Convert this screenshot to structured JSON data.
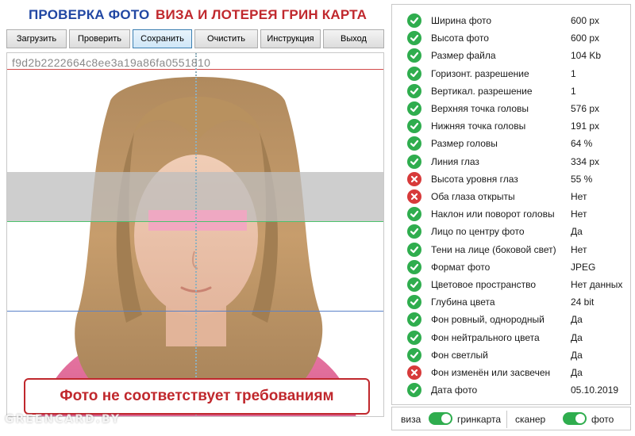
{
  "header": {
    "title_main": "ПРОВЕРКА ФОТО",
    "title_sub": "ВИЗА И ЛОТЕРЕЯ ГРИН КАРТА"
  },
  "toolbar": {
    "buttons": [
      {
        "label": "Загрузить",
        "active": false
      },
      {
        "label": "Проверить",
        "active": false
      },
      {
        "label": "Сохранить",
        "active": true
      },
      {
        "label": "Очистить",
        "active": false
      },
      {
        "label": "Инструкция",
        "active": false
      },
      {
        "label": "Выход",
        "active": false
      }
    ]
  },
  "photo": {
    "hash": "f9d2b2222664c8ee3a19a86fa0551810",
    "status_text": "Фото не соответствует требованиям",
    "watermark": "GREENCARD.BY"
  },
  "checks": [
    {
      "label": "Ширина фото",
      "value": "600 px",
      "status": "ok"
    },
    {
      "label": "Высота фото",
      "value": "600 px",
      "status": "ok"
    },
    {
      "label": "Размер файла",
      "value": "104 Kb",
      "status": "ok"
    },
    {
      "label": "Горизонт. разрешение",
      "value": "1",
      "status": "ok"
    },
    {
      "label": "Вертикал. разрешение",
      "value": "1",
      "status": "ok"
    },
    {
      "label": "Верхняя точка головы",
      "value": "576 px",
      "status": "ok"
    },
    {
      "label": "Нижняя точка головы",
      "value": "191 px",
      "status": "ok"
    },
    {
      "label": "Размер головы",
      "value": "64 %",
      "status": "ok"
    },
    {
      "label": "Линия глаз",
      "value": "334 px",
      "status": "ok"
    },
    {
      "label": "Высота уровня глаз",
      "value": "55 %",
      "status": "bad"
    },
    {
      "label": "Оба глаза открыты",
      "value": "Нет",
      "status": "bad"
    },
    {
      "label": "Наклон или поворот головы",
      "value": "Нет",
      "status": "ok"
    },
    {
      "label": "Лицо по центру фото",
      "value": "Да",
      "status": "ok"
    },
    {
      "label": "Тени на лице (боковой свет)",
      "value": "Нет",
      "status": "ok"
    },
    {
      "label": "Формат фото",
      "value": "JPEG",
      "status": "ok"
    },
    {
      "label": "Цветовое пространство",
      "value": "Нет данных",
      "status": "ok"
    },
    {
      "label": "Глубина цвета",
      "value": "24 bit",
      "status": "ok"
    },
    {
      "label": "Фон ровный, однородный",
      "value": "Да",
      "status": "ok"
    },
    {
      "label": "Фон нейтрального цвета",
      "value": "Да",
      "status": "ok"
    },
    {
      "label": "Фон светлый",
      "value": "Да",
      "status": "ok"
    },
    {
      "label": "Фон изменён или засвечен",
      "value": "Да",
      "status": "bad"
    },
    {
      "label": "Дата фото",
      "value": "05.10.2019",
      "status": "ok"
    }
  ],
  "toggles": {
    "mode": {
      "left": "виза",
      "right": "гринкарта",
      "on": true
    },
    "source": {
      "left": "сканер",
      "right": "фото",
      "on": true
    }
  },
  "colors": {
    "ok": "#2fad4e",
    "bad": "#d73a3a",
    "title_blue": "#2147a3",
    "title_red": "#c0282d"
  }
}
